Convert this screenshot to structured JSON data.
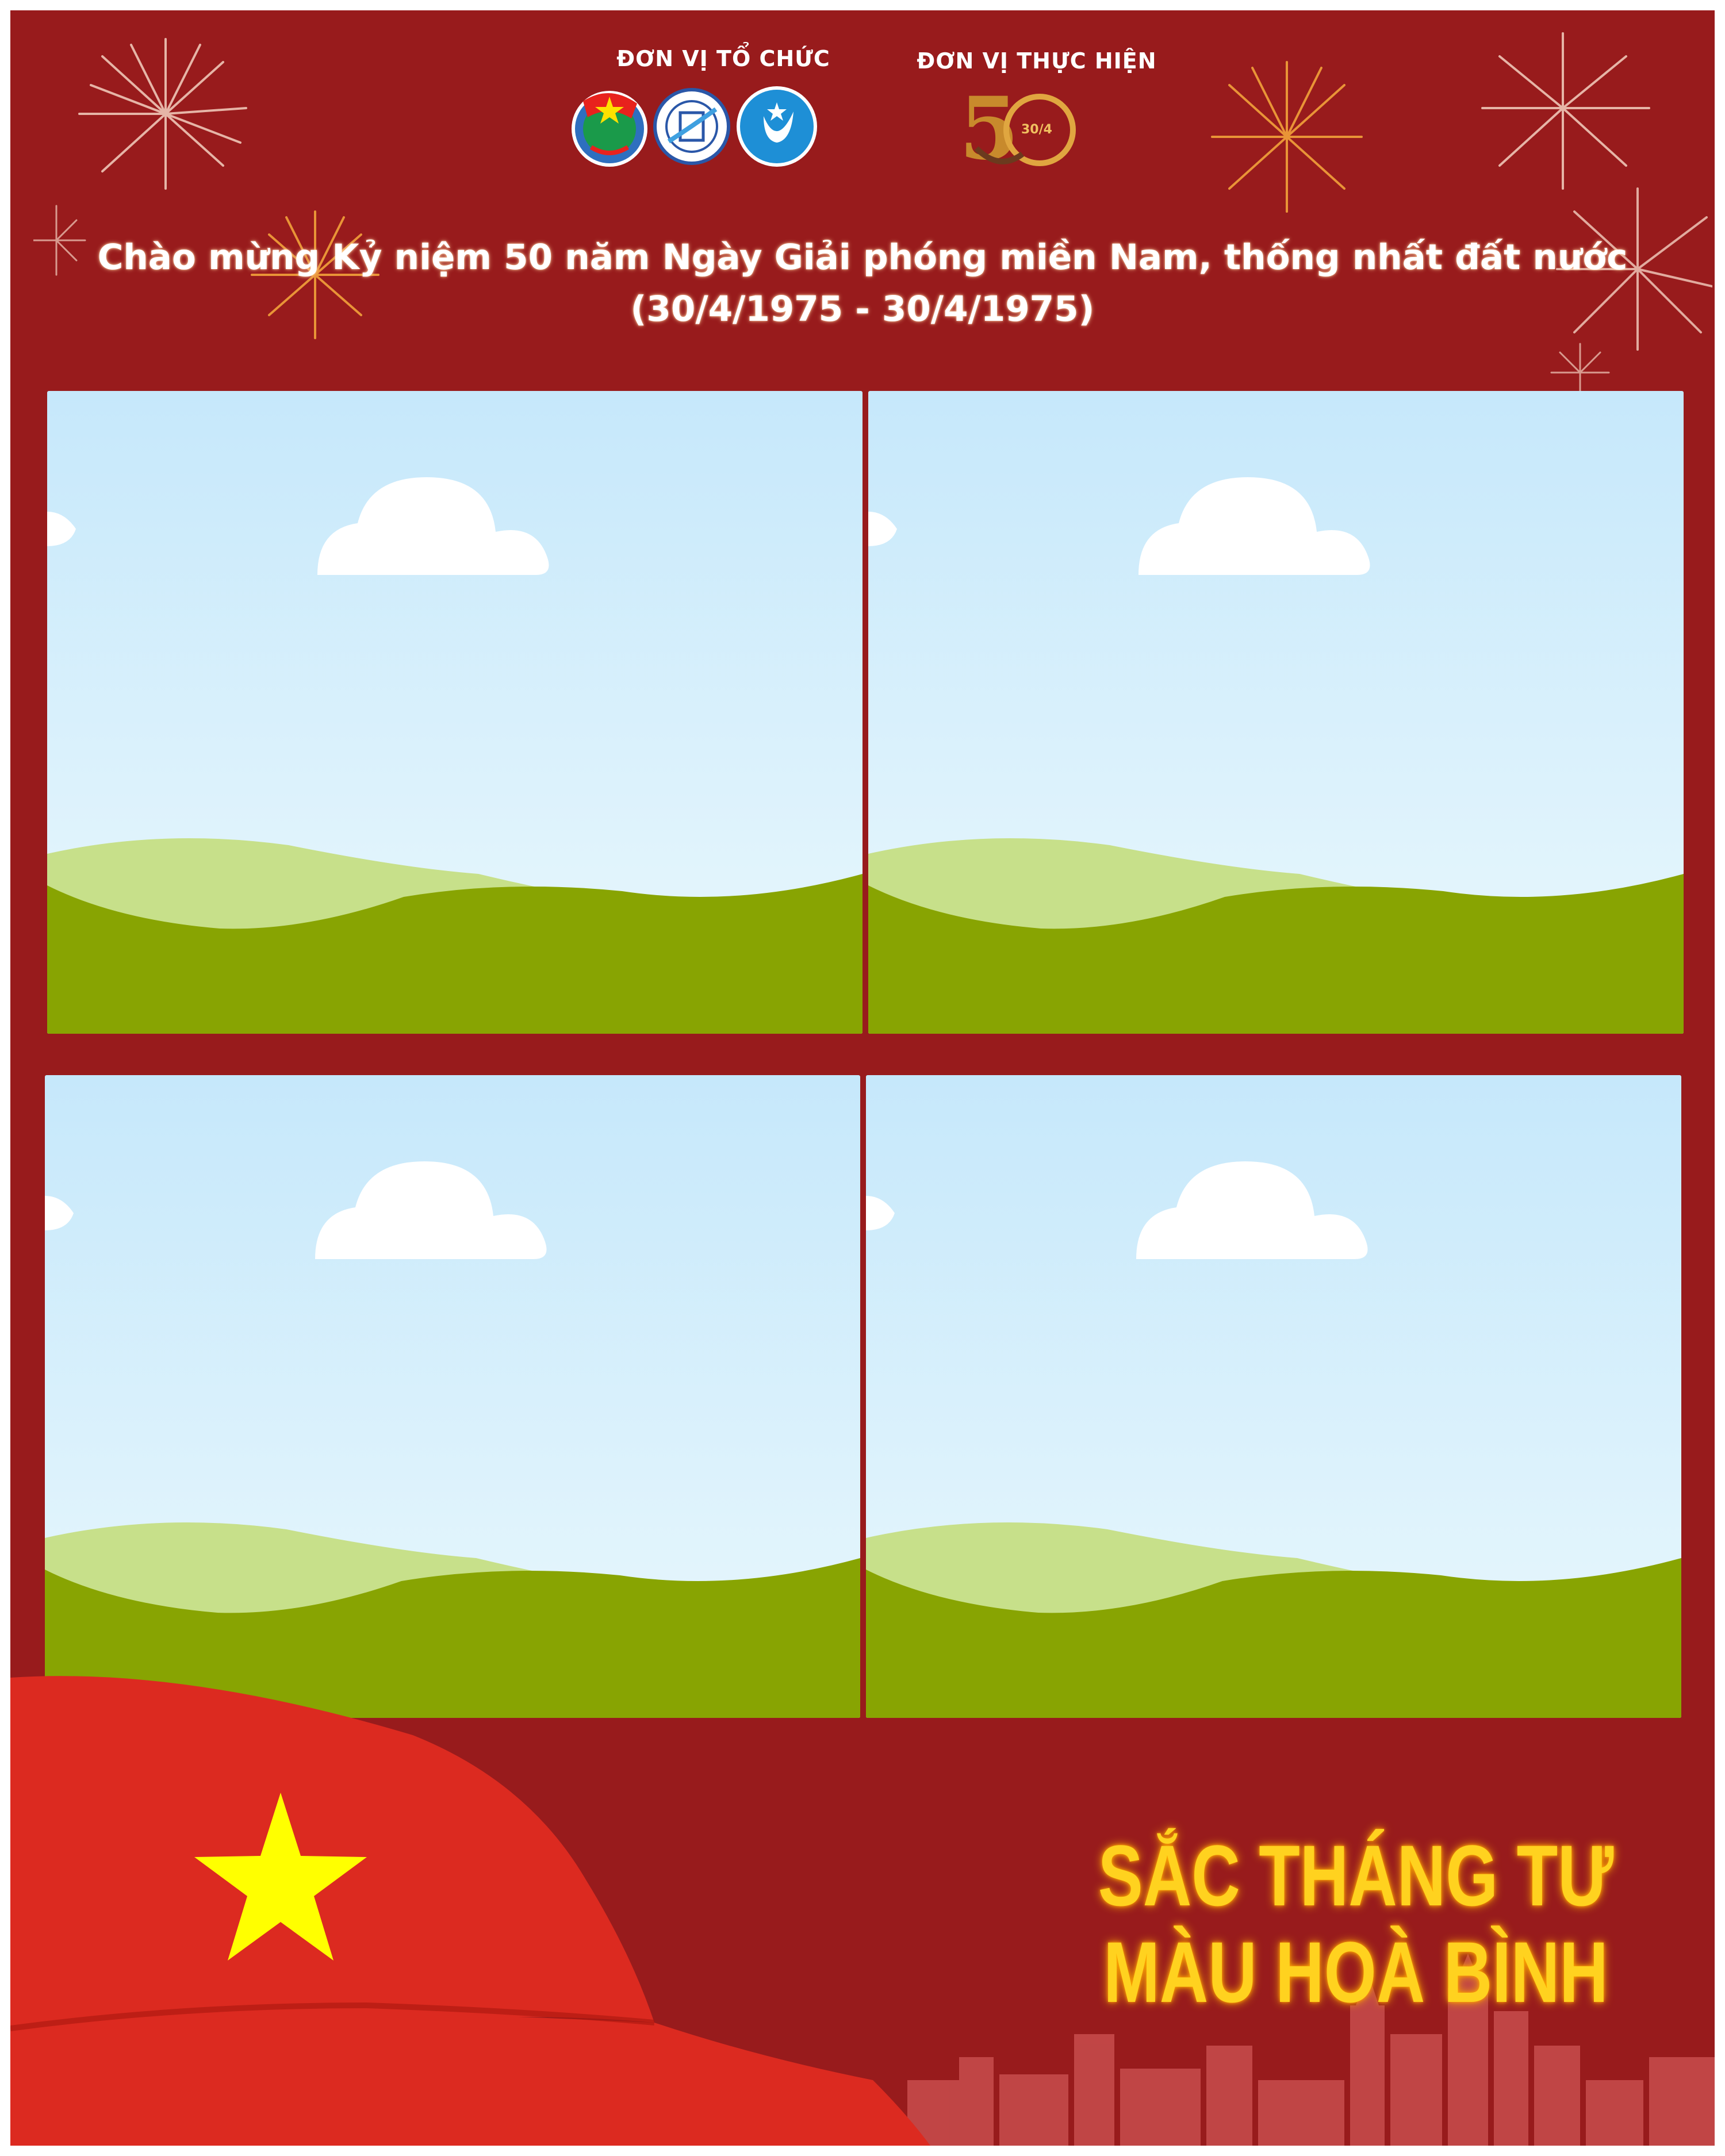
{
  "organizer": {
    "label": "ĐƠN VỊ TỔ CHỨC",
    "logos": [
      "youth-union-logo",
      "school-logo",
      "student-association-logo"
    ]
  },
  "implementer": {
    "label": "ĐƠN VỊ THỰC HIỆN",
    "logos": [
      "50-years-april-logo"
    ]
  },
  "title": {
    "line1": "Chào mừng Kỷ niệm 50 năm Ngày Giải phóng miền Nam, thống nhất đất nước",
    "line2": "(30/4/1975 - 30/4/1975)"
  },
  "photo_slots": [
    "photo-slot-1",
    "photo-slot-2",
    "photo-slot-3",
    "photo-slot-4"
  ],
  "slogan": {
    "line1": "SẮC THÁNG TƯ",
    "line2": "MÀU HOÀ BÌNH"
  },
  "colors": {
    "background": "#981b1c",
    "flag_red": "#dc2a20",
    "star": "#ffff00",
    "slogan": "#ffd21f",
    "sky": "#dff3fb",
    "grass": "#88a402",
    "grass_light": "#c7e08a"
  }
}
